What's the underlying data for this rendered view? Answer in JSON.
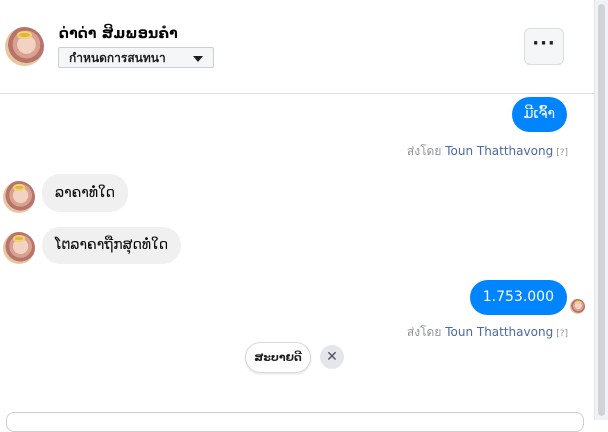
{
  "header": {
    "contact_name": "ດ່າດ່າ ສິມພອນຄໍາ",
    "conversation_select": "กำหนดการสนทนา",
    "more_label": "···"
  },
  "messages": [
    {
      "direction": "out",
      "text": "ມີເຈົ້າ"
    },
    {
      "direction": "in",
      "text": "ລາຄາທໍ່ໃດ"
    },
    {
      "direction": "in",
      "text": "ໂຕລາຄາຖືກສຸດທໍ່ໃດ"
    },
    {
      "direction": "out",
      "text": "1.753.000"
    }
  ],
  "sent_by": [
    {
      "prefix": "ส่งโดย",
      "name": "Toun Thatthavong",
      "help": "[?]"
    },
    {
      "prefix": "ส่งโดย",
      "name": "Toun Thatthavong",
      "help": "[?]"
    }
  ],
  "quick_reply": {
    "label": "ສະບາຍດີ",
    "dismiss": "✕"
  },
  "colors": {
    "outgoing_bubble": "#0084ff",
    "incoming_bubble": "#f0f0f0",
    "sent_by_name": "#4b6aa3"
  }
}
